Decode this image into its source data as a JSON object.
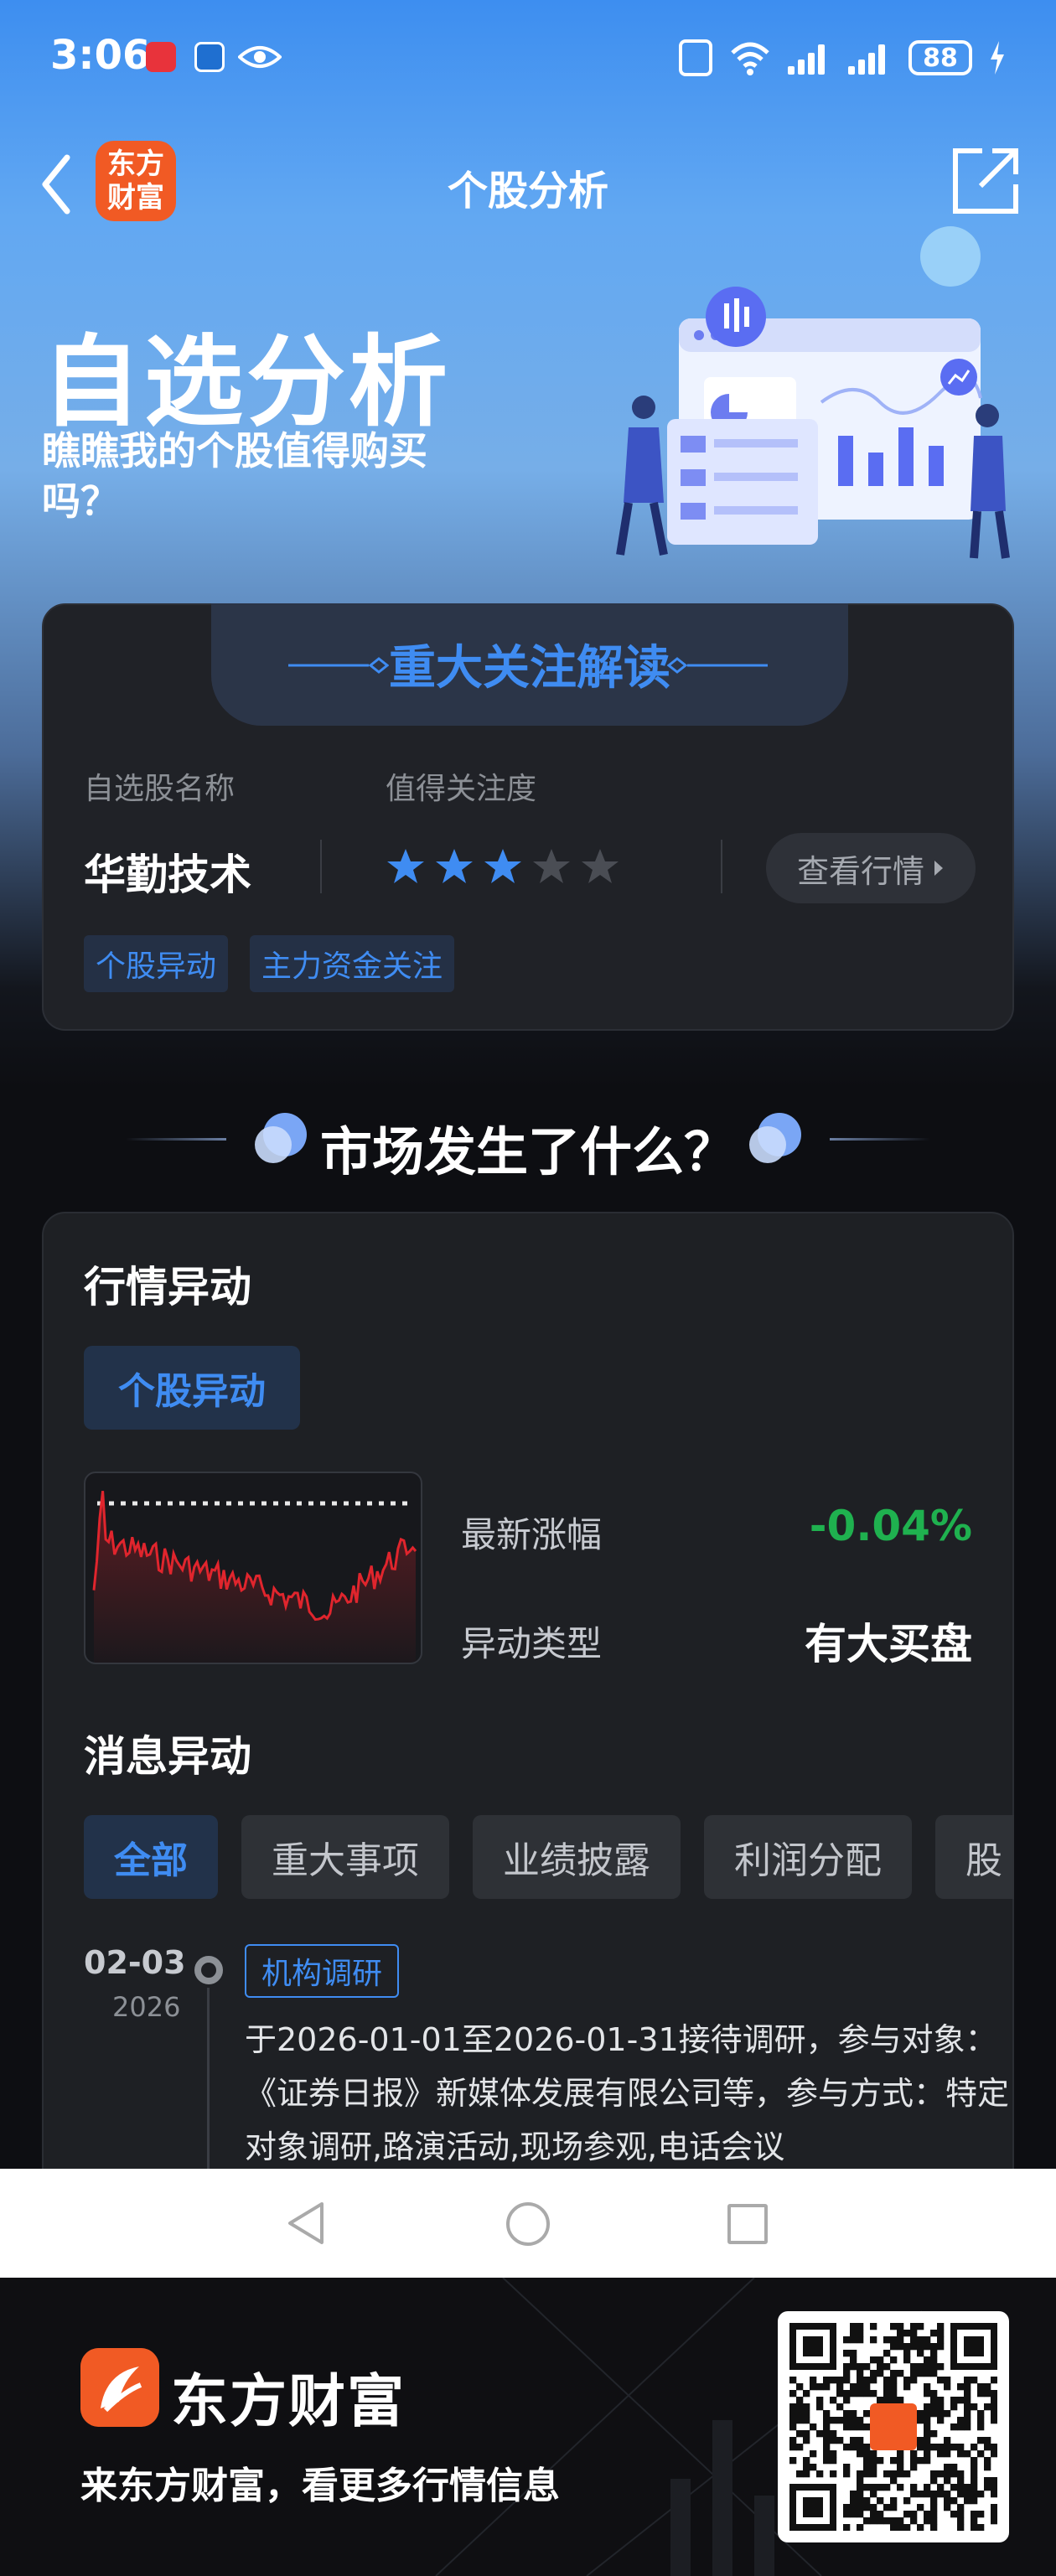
{
  "status_bar": {
    "time": "3:06",
    "battery": "88"
  },
  "nav": {
    "logo_text": "东方\n财富",
    "title": "个股分析"
  },
  "hero": {
    "title": "自选分析",
    "subtitle": "瞧瞧我的个股值得购买吗？"
  },
  "focus_card": {
    "heading": "重大关注解读",
    "stock_label": "自选股名称",
    "attention_label": "值得关注度",
    "stock_name": "华勤技术",
    "rating": 3,
    "rating_max": 5,
    "view_button": "查看行情",
    "tags": [
      "个股异动",
      "主力资金关注"
    ]
  },
  "section": {
    "title": "市场发生了什么？"
  },
  "market_card": {
    "heading": "行情异动",
    "chip": "个股异动",
    "rows": [
      {
        "label": "最新涨幅",
        "value": "-0.04%"
      },
      {
        "label": "异动类型",
        "value": "有大买盘"
      }
    ],
    "news_heading": "消息异动",
    "news_tabs": [
      "全部",
      "重大事项",
      "业绩披露",
      "利润分配",
      "股"
    ],
    "news_item": {
      "date": "02-03",
      "year": "2026",
      "tag": "机构调研",
      "text": "于2026-01-01至2026-01-31接待调研，参与对象：《证券日报》新媒体发展有限公司等，参与方式：特定对象调研,路演活动,现场参观,电话会议"
    }
  },
  "footer": {
    "brand": "东方财富",
    "slogan": "来东方财富，看更多行情信息"
  },
  "colors": {
    "accent": "#3f8cf2",
    "down": "#1fb14f",
    "brand": "#f15a24",
    "chart_line": "#e0252d"
  }
}
